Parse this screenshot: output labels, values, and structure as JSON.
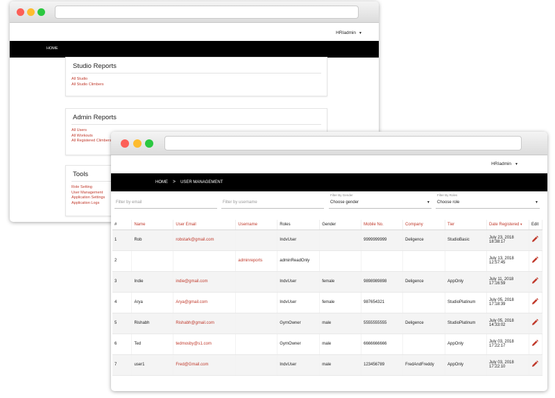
{
  "back_window": {
    "user_menu": "HRIadmin",
    "nav_home": "HOME",
    "cards": [
      {
        "title": "Studio Reports",
        "links": [
          "All Studio",
          "All Studio Climbers"
        ]
      },
      {
        "title": "Admin Reports",
        "links": [
          "All Users",
          "All Workouts",
          "All Registered Climbers"
        ]
      },
      {
        "title": "Tools",
        "links": [
          "Role Setting",
          "User Management",
          "Application Settings",
          "Application Logs"
        ]
      }
    ]
  },
  "front_window": {
    "user_menu": "HRIadmin",
    "breadcrumb": {
      "home": "HOME",
      "separator": ">",
      "current": "USER MANAGEMENT"
    },
    "filters": {
      "email": {
        "placeholder": "Filter by email"
      },
      "username": {
        "placeholder": "Filter by username"
      },
      "gender": {
        "label": "Filter By Gender",
        "value": "Choose gender"
      },
      "roles": {
        "label": "Filter By Roles",
        "value": "Choose role"
      }
    },
    "table": {
      "headers": [
        "#",
        "Name",
        "User Email",
        "Username",
        "Roles",
        "Gender",
        "Mobile No.",
        "Company",
        "Tier",
        "Date Registered",
        "Edit"
      ],
      "sort_indicator": "▾",
      "rows": [
        [
          "1",
          "Rob",
          "robstark@gmail.com",
          "",
          "IndvUser",
          "",
          "9999999999",
          "Deligence",
          "StudioBasic",
          "July 23, 2018",
          "18:38:17"
        ],
        [
          "2",
          "",
          "",
          "adminreports",
          "adminReadOnly",
          "",
          "",
          "",
          "",
          "July 13, 2018",
          "12:57:45"
        ],
        [
          "3",
          "Indie",
          "indie@gmail.com",
          "",
          "IndvUser",
          "female",
          "9898989898",
          "Deligence",
          "AppOnly",
          "July 11, 2018",
          "17:16:59"
        ],
        [
          "4",
          "Arya",
          "Arya@gmail.com",
          "",
          "IndvUser",
          "female",
          "987654321",
          "",
          "StudioPlatinum",
          "July 05, 2018",
          "17:18:39"
        ],
        [
          "5",
          "Rishabh",
          "Rishabh@gmail.com",
          "",
          "GymOwner",
          "male",
          "5555555555",
          "Deligence",
          "StudioPlatinum",
          "July 05, 2018",
          "14:33:02"
        ],
        [
          "6",
          "Ted",
          "tedmosby@s1.com",
          "",
          "GymOwner",
          "male",
          "6666666666",
          "",
          "AppOnly",
          "July 03, 2018",
          "17:22:17"
        ],
        [
          "7",
          "user1",
          "Fred@Gmail.com",
          "",
          "IndvUser",
          "male",
          "123456789",
          "FredAndFreddy",
          "AppOnly",
          "July 03, 2018",
          "17:22:10"
        ]
      ]
    }
  },
  "colors": {
    "accent": "#c0392b",
    "navbar": "#000000"
  },
  "icons": {
    "edit": "pencil-icon",
    "dropdown": "caret-down-icon"
  }
}
